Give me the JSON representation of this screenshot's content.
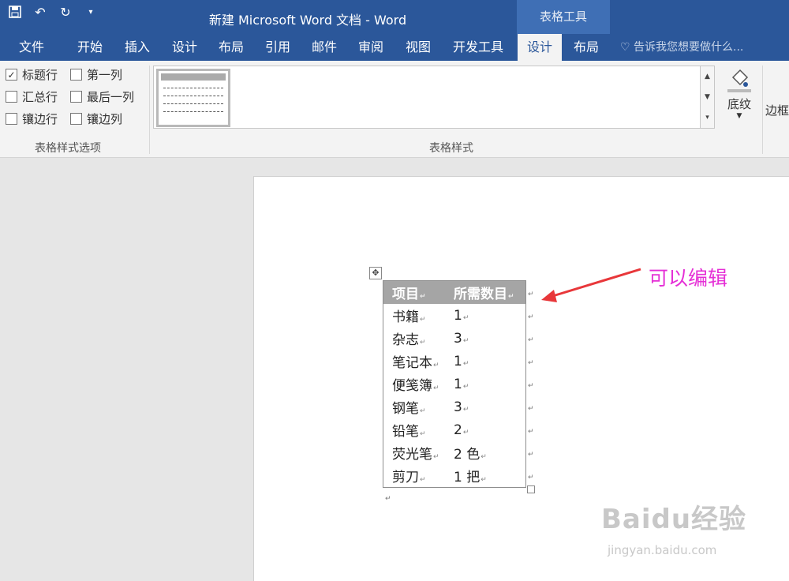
{
  "window": {
    "title": "新建 Microsoft Word 文档 - Word",
    "contextual_tab_group": "表格工具"
  },
  "tabs": [
    {
      "label": "文件"
    },
    {
      "label": "开始"
    },
    {
      "label": "插入"
    },
    {
      "label": "设计"
    },
    {
      "label": "布局"
    },
    {
      "label": "引用"
    },
    {
      "label": "邮件"
    },
    {
      "label": "审阅"
    },
    {
      "label": "视图"
    },
    {
      "label": "开发工具"
    },
    {
      "label": "设计",
      "active": true
    },
    {
      "label": "布局"
    }
  ],
  "tellme": {
    "placeholder": "告诉我您想要做什么..."
  },
  "ribbon": {
    "options_group_label": "表格样式选项",
    "styles_group_label": "表格样式",
    "checkboxes": [
      {
        "label": "标题行",
        "checked": true
      },
      {
        "label": "第一列",
        "checked": false
      },
      {
        "label": "汇总行",
        "checked": false
      },
      {
        "label": "最后一列",
        "checked": false
      },
      {
        "label": "镶边行",
        "checked": false
      },
      {
        "label": "镶边列",
        "checked": false
      }
    ],
    "shading_label": "底纹",
    "border_label": "边框"
  },
  "table": {
    "header": [
      "项目",
      "所需数目"
    ],
    "rows": [
      [
        "书籍",
        "1"
      ],
      [
        "杂志",
        "3"
      ],
      [
        "笔记本",
        "1"
      ],
      [
        "便笺簿",
        "1"
      ],
      [
        "钢笔",
        "3"
      ],
      [
        "铅笔",
        "2"
      ],
      [
        "荧光笔",
        "2 色"
      ],
      [
        "剪刀",
        "1 把"
      ]
    ]
  },
  "annotation": "可以编辑",
  "watermark": {
    "brand": "Baidu经验",
    "url": "jingyan.baidu.com"
  },
  "colors": {
    "accent": "#2b579a",
    "annotation": "#e52fd6"
  }
}
